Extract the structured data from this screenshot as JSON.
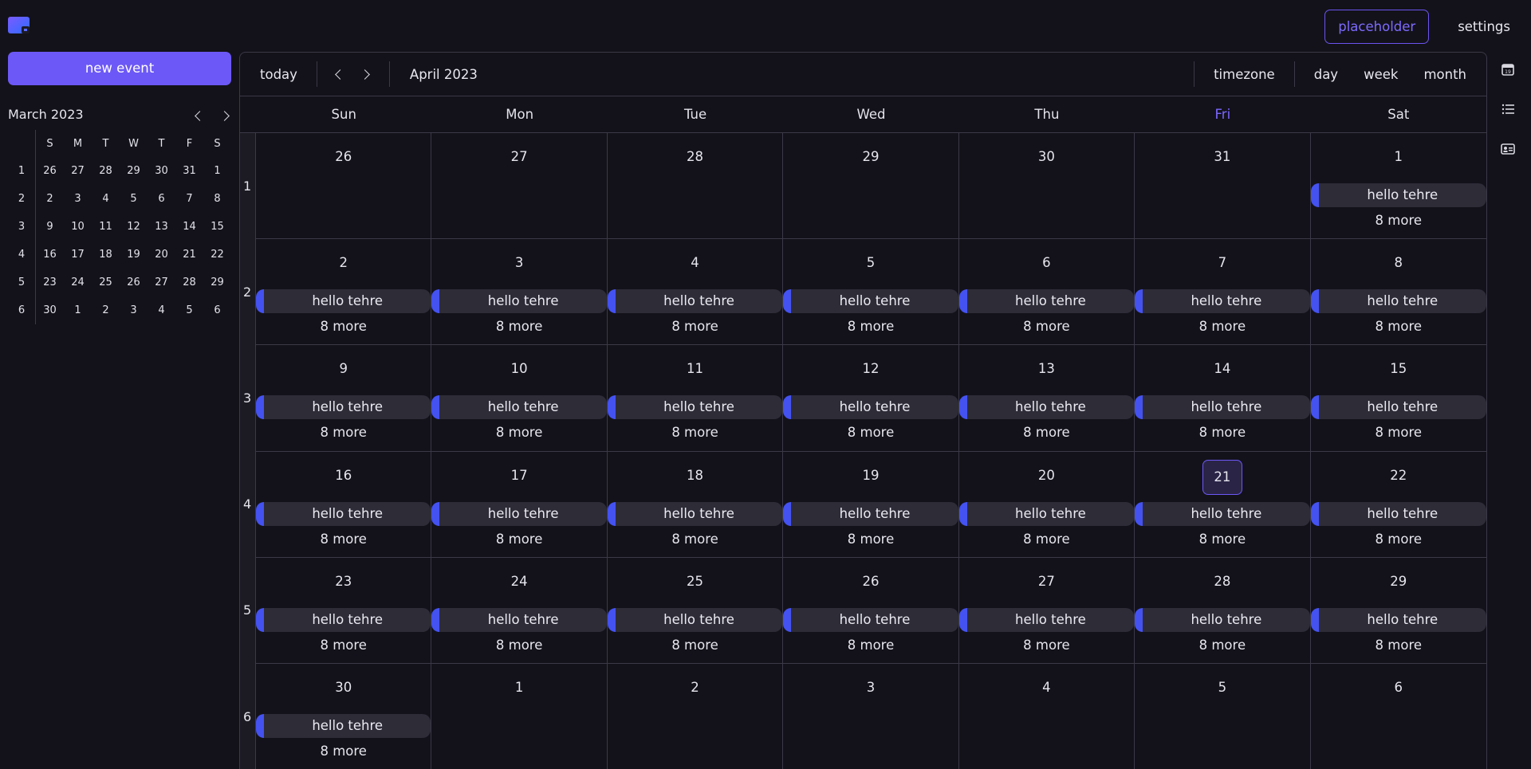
{
  "header": {
    "placeholder_label": "placeholder",
    "settings_label": "settings"
  },
  "sidebar": {
    "new_event_label": "new event",
    "mini_calendar": {
      "title": "March 2023",
      "day_headers": [
        "S",
        "M",
        "T",
        "W",
        "T",
        "F",
        "S"
      ],
      "weeks": [
        {
          "num": "1",
          "days": [
            "26",
            "27",
            "28",
            "29",
            "30",
            "31",
            "1"
          ]
        },
        {
          "num": "2",
          "days": [
            "2",
            "3",
            "4",
            "5",
            "6",
            "7",
            "8"
          ]
        },
        {
          "num": "3",
          "days": [
            "9",
            "10",
            "11",
            "12",
            "13",
            "14",
            "15"
          ]
        },
        {
          "num": "4",
          "days": [
            "16",
            "17",
            "18",
            "19",
            "20",
            "21",
            "22"
          ]
        },
        {
          "num": "5",
          "days": [
            "23",
            "24",
            "25",
            "26",
            "27",
            "28",
            "29"
          ]
        },
        {
          "num": "6",
          "days": [
            "30",
            "1",
            "2",
            "3",
            "4",
            "5",
            "6"
          ]
        }
      ]
    }
  },
  "toolbar": {
    "today_label": "today",
    "month_label": "April 2023",
    "timezone_label": "timezone",
    "day_label": "day",
    "week_label": "week",
    "month_view_label": "month"
  },
  "calendar": {
    "day_headers": [
      "Sun",
      "Mon",
      "Tue",
      "Wed",
      "Thu",
      "Fri",
      "Sat"
    ],
    "today_column": 5,
    "selected_date": "21",
    "event_title": "hello tehre",
    "more_label": "8 more",
    "weeks": [
      {
        "num": "1",
        "days": [
          "26",
          "27",
          "28",
          "29",
          "30",
          "31",
          "1"
        ],
        "events": [
          false,
          false,
          false,
          false,
          false,
          false,
          true
        ]
      },
      {
        "num": "2",
        "days": [
          "2",
          "3",
          "4",
          "5",
          "6",
          "7",
          "8"
        ],
        "events": [
          true,
          true,
          true,
          true,
          true,
          true,
          true
        ]
      },
      {
        "num": "3",
        "days": [
          "9",
          "10",
          "11",
          "12",
          "13",
          "14",
          "15"
        ],
        "events": [
          true,
          true,
          true,
          true,
          true,
          true,
          true
        ]
      },
      {
        "num": "4",
        "days": [
          "16",
          "17",
          "18",
          "19",
          "20",
          "21",
          "22"
        ],
        "events": [
          true,
          true,
          true,
          true,
          true,
          true,
          true
        ]
      },
      {
        "num": "5",
        "days": [
          "23",
          "24",
          "25",
          "26",
          "27",
          "28",
          "29"
        ],
        "events": [
          true,
          true,
          true,
          true,
          true,
          true,
          true
        ]
      },
      {
        "num": "6",
        "days": [
          "30",
          "1",
          "2",
          "3",
          "4",
          "5",
          "6"
        ],
        "events": [
          true,
          false,
          false,
          false,
          false,
          false,
          false
        ]
      }
    ]
  },
  "colors": {
    "accent": "#6c58f6",
    "event_bar": "#4452f0",
    "background": "#13121a"
  },
  "side_icons": [
    "calendar-icon",
    "list-icon",
    "contact-card-icon"
  ]
}
